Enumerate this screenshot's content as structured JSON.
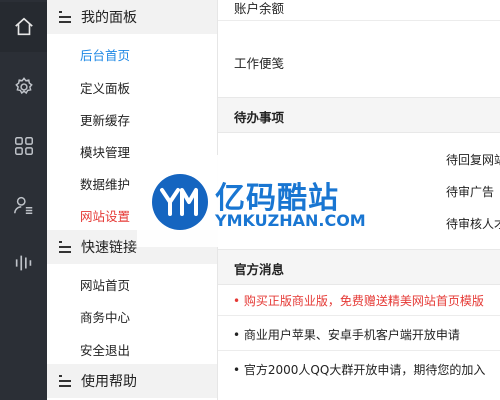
{
  "rail": {
    "icons": [
      "home-icon",
      "gear-icon",
      "grid-icon",
      "user-list-icon",
      "bars-icon"
    ]
  },
  "sidebar": {
    "groups": [
      {
        "title": "我的面板",
        "items": [
          "后台首页",
          "定义面板",
          "更新缓存",
          "模块管理",
          "数据维护",
          "网站设置"
        ]
      },
      {
        "title": "快速链接",
        "items": [
          "网站首页",
          "商务中心",
          "安全退出"
        ]
      },
      {
        "title": "使用帮助"
      }
    ]
  },
  "main": {
    "account_balance": "账户余额",
    "work_notes": "工作便笺",
    "todo": {
      "title": "待办事项",
      "items": [
        "待回复网站",
        "待审广告",
        "待审核人才"
      ]
    },
    "news": {
      "title": "官方消息",
      "items": [
        "• 购买正版商业版，免费赠送精美网站首页模版",
        "• 商业用户苹果、安卓手机客户端开放申请",
        "• 官方2000人QQ大群开放申请，期待您的加入"
      ]
    }
  },
  "watermark": {
    "title": "亿码酷站",
    "url": "YMKUZHAN.COM"
  },
  "colors": {
    "rail_bg": "#2b2f36",
    "active": "#1e88e5",
    "danger": "#e53935",
    "brand": "#1976d2"
  }
}
